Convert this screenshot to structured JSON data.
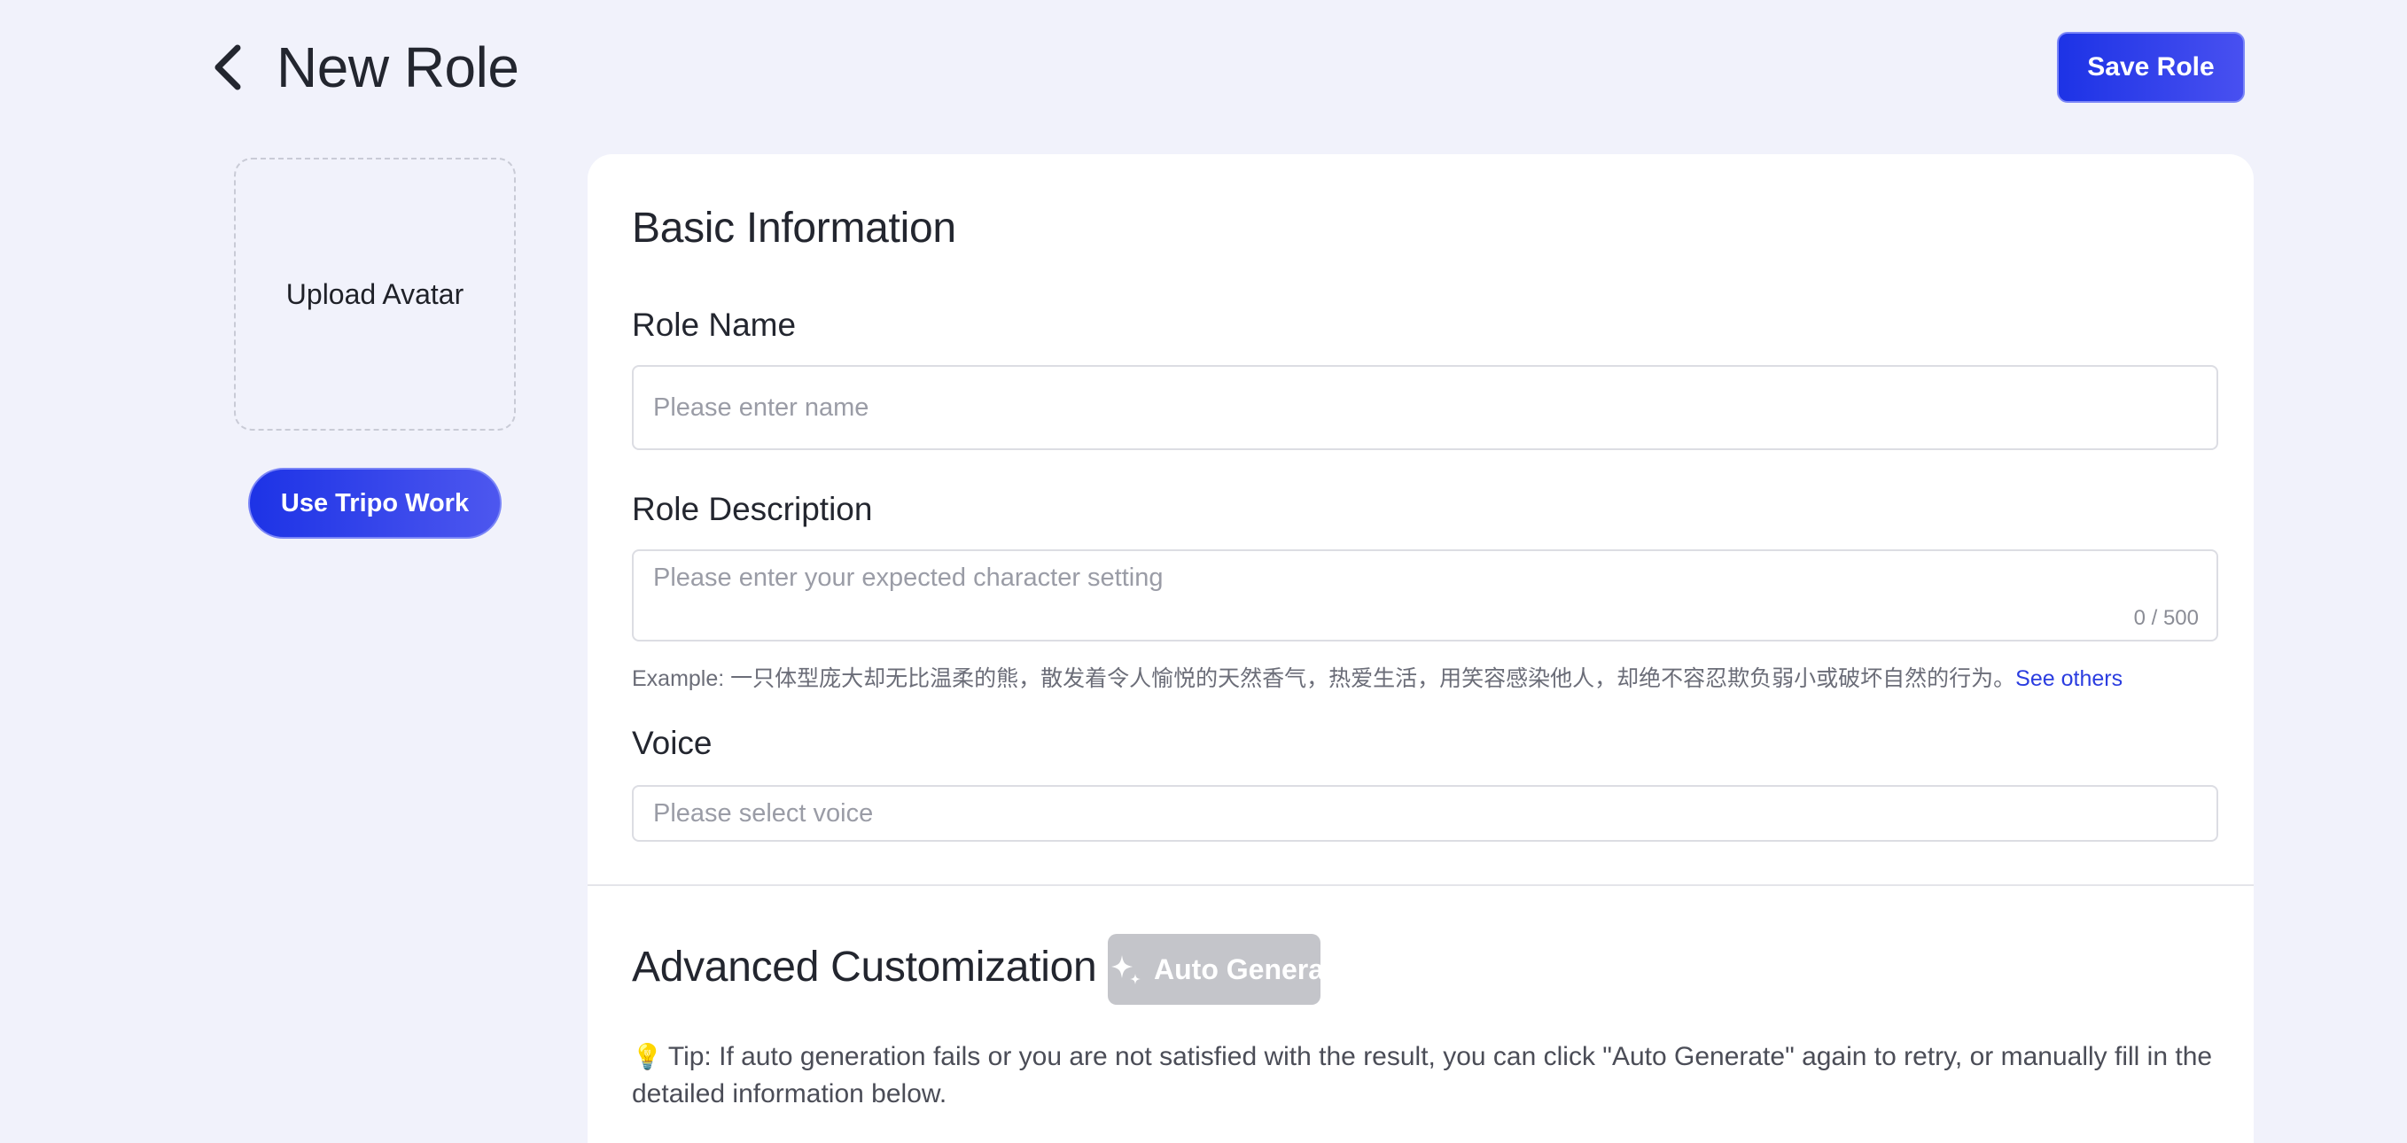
{
  "header": {
    "title": "New Role",
    "save_label": "Save Role"
  },
  "sidebar": {
    "upload_avatar_label": "Upload Avatar",
    "use_tripo_label": "Use Tripo Work"
  },
  "basic_info": {
    "title": "Basic Information",
    "role_name": {
      "label": "Role Name",
      "placeholder": "Please enter name",
      "value": ""
    },
    "role_description": {
      "label": "Role Description",
      "placeholder": "Please enter your expected character setting",
      "value": "",
      "counter": "0 / 500",
      "example_text": "Example: 一只体型庞大却无比温柔的熊，散发着令人愉悦的天然香气，热爱生活，用笑容感染他人，却绝不容忍欺负弱小或破坏自然的行为。",
      "see_others": "See others"
    },
    "voice": {
      "label": "Voice",
      "placeholder": "Please select voice",
      "selected": ""
    }
  },
  "advanced": {
    "title": "Advanced Customization",
    "auto_generate_label": "Auto Generate",
    "tip_icon": "lightbulb-icon",
    "tip_text": "Tip: If auto generation fails or you are not satisfied with the result, you can click \"Auto Generate\" again to retry, or manually fill in the detailed information below."
  },
  "colors": {
    "accent": "#1d33e6",
    "page_background": "#f1f2fb",
    "disabled_button": "#c4c5ca",
    "link": "#2b3de0"
  }
}
